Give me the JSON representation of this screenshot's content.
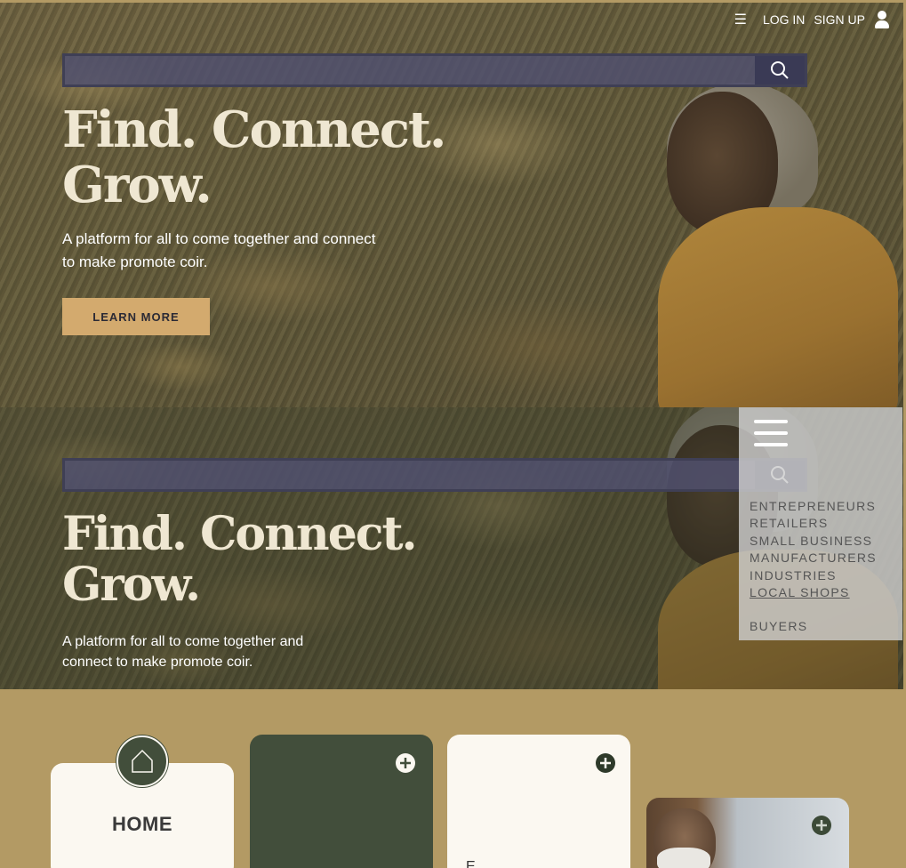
{
  "header": {
    "menu_icon": "hamburger-icon",
    "login_label": "LOG IN",
    "signup_label": "SIGN UP",
    "user_icon": "user-icon"
  },
  "hero": {
    "search_placeholder": "",
    "headline_line1": "Find. Connect.",
    "headline_line2": "Grow.",
    "subtitle": "A platform for all to come together and connect to make promote coir.",
    "cta_label": "LEARN MORE",
    "accent_color": "#d3aa6e"
  },
  "hero_mobile": {
    "headline_line1": "Find. Connect.",
    "headline_line2": "Grow.",
    "subtitle": "A platform for all to come together and connect to make promote coir."
  },
  "dropdown": {
    "items": [
      {
        "label": "ENTREPRENEURS"
      },
      {
        "label": "RETAILERS"
      },
      {
        "label": "SMALL BUSINESS"
      },
      {
        "label": "MANUFACTURERS"
      },
      {
        "label": "INDUSTRIES"
      },
      {
        "label": "LOCAL SHOPS"
      },
      {
        "label": "BUYERS"
      }
    ],
    "active_item": "LOCAL SHOPS"
  },
  "cards": {
    "home_label": "HOME",
    "home_icon": "house-icon",
    "cream_label": "E",
    "colors": {
      "green": "#424e3b",
      "cream": "#fbf8f1",
      "section": "#b39a64"
    }
  }
}
